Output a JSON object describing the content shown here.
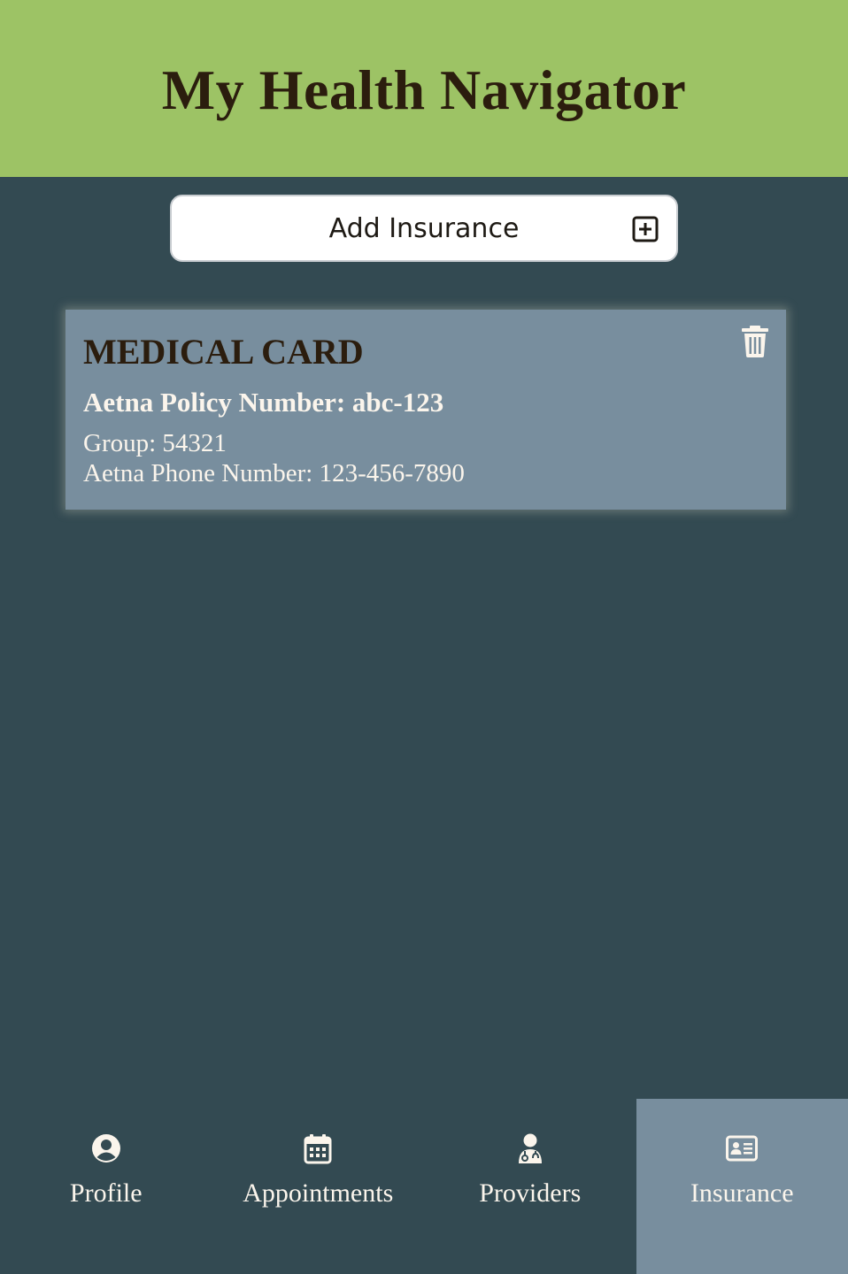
{
  "header": {
    "title": "My Health Navigator"
  },
  "add_insurance": {
    "label": "Add Insurance",
    "icon": "plus-square-icon"
  },
  "insurance_cards": [
    {
      "title": "MEDICAL CARD",
      "policy": "Aetna Policy Number: abc-123",
      "group": "Group: 54321",
      "phone": "Aetna Phone Number: 123-456-7890",
      "delete_icon": "trash-icon"
    }
  ],
  "nav": {
    "items": [
      {
        "label": "Profile",
        "icon": "user-circle-icon",
        "active": false
      },
      {
        "label": "Appointments",
        "icon": "calendar-icon",
        "active": false
      },
      {
        "label": "Providers",
        "icon": "doctor-icon",
        "active": false
      },
      {
        "label": "Insurance",
        "icon": "id-card-icon",
        "active": true
      }
    ]
  },
  "colors": {
    "header_bg": "#9dc365",
    "page_bg": "#334a52",
    "card_bg": "#788e9e",
    "title_text": "#2b1d0e",
    "light_text": "#fbf5ec"
  }
}
